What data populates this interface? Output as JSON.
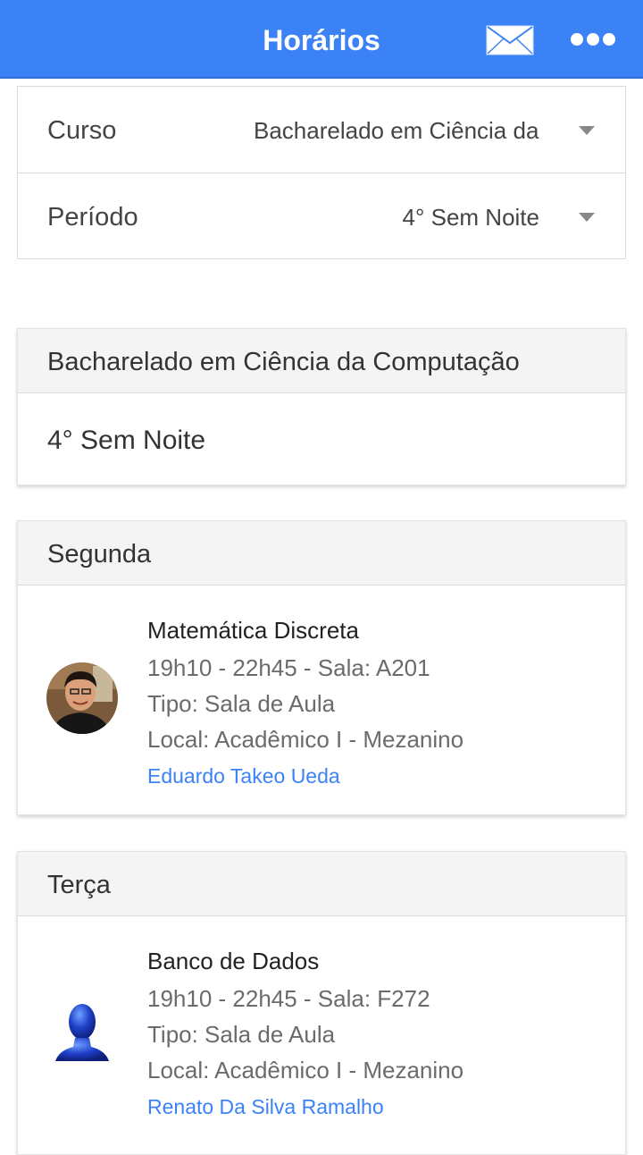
{
  "header": {
    "title": "Horários",
    "mail_icon": "mail-icon",
    "more_icon": "more-dots-icon",
    "accent_color": "#3b82f6"
  },
  "filters": {
    "course_label": "Curso",
    "course_value": "Bacharelado em Ciência da Computação",
    "period_label": "Período",
    "period_value": "4° Sem Noite"
  },
  "summary": {
    "course": "Bacharelado em Ciência da Computação",
    "period": "4° Sem Noite"
  },
  "days": [
    {
      "name": "Segunda",
      "classes": [
        {
          "subject": "Matemática Discreta",
          "time": "19h10 - 22h45 - Sala: A201",
          "type": "Tipo: Sala de Aula",
          "location": "Local: Acadêmico I - Mezanino",
          "teacher": "Eduardo Takeo Ueda",
          "avatar": "teacher-photo"
        }
      ]
    },
    {
      "name": "Terça",
      "classes": [
        {
          "subject": "Banco de Dados",
          "time": "19h10 - 22h45 - Sala: F272",
          "type": "Tipo: Sala de Aula",
          "location": "Local: Acadêmico I - Mezanino",
          "teacher": "Renato Da Silva Ramalho",
          "avatar": "default-user-icon"
        }
      ]
    }
  ]
}
